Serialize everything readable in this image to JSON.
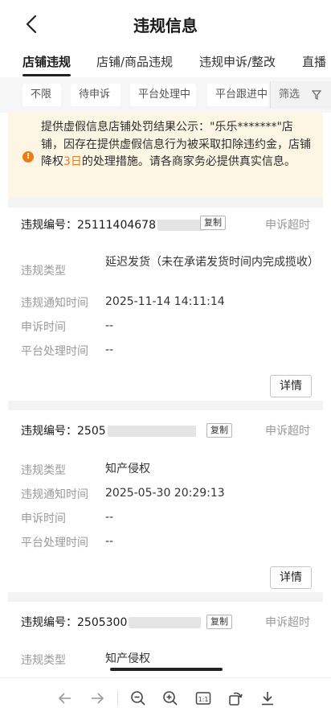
{
  "header": {
    "title": "违规信息"
  },
  "tabs": [
    {
      "label": "店铺违规"
    },
    {
      "label": "店铺/商品违规"
    },
    {
      "label": "违规申诉/整改"
    },
    {
      "label": "直播"
    }
  ],
  "filters": {
    "chips": [
      {
        "label": "不限"
      },
      {
        "label": "待申诉"
      },
      {
        "label": "平台处理中"
      },
      {
        "label": "平台跟进中"
      }
    ],
    "filter_label": "筛选"
  },
  "notice": {
    "text_before": "提供虚假信息店铺处罚结果公示：\"乐乐*******\"店铺，因存在提供虚假信息行为被采取扣除违约金，店铺降权",
    "highlight": "3日",
    "text_after": "的处理措施。请各商家务必提供真实信息。",
    "accent_color": "#f07b12"
  },
  "labels": {
    "id_prefix": "违规编号：",
    "copy": "复制",
    "type": "违规类型",
    "notice_time": "违规通知时间",
    "appeal_time": "申诉时间",
    "platform_time": "平台处理时间",
    "details": "详情"
  },
  "violations": [
    {
      "id_visible": "25111404678",
      "status": "申诉超时",
      "type": "延迟发货（未在承诺发货时间内完成揽收）",
      "notice_time": "2025-11-14 14:11:14",
      "appeal_time": "--",
      "platform_time": "--"
    },
    {
      "id_visible": "2505",
      "status": "申诉超时",
      "type": "知产侵权",
      "notice_time": "2025-05-30 20:29:13",
      "appeal_time": "--",
      "platform_time": "--"
    },
    {
      "id_visible": "2505300",
      "status": "申诉超时",
      "type": "知产侵权"
    }
  ],
  "bottom_toolbar": {
    "icons": [
      "arrow-left-icon",
      "arrow-right-icon",
      "zoom-out-icon",
      "zoom-in-icon",
      "actual-size-icon",
      "rotate-icon",
      "download-icon"
    ],
    "actual_size_label": "1:1"
  }
}
